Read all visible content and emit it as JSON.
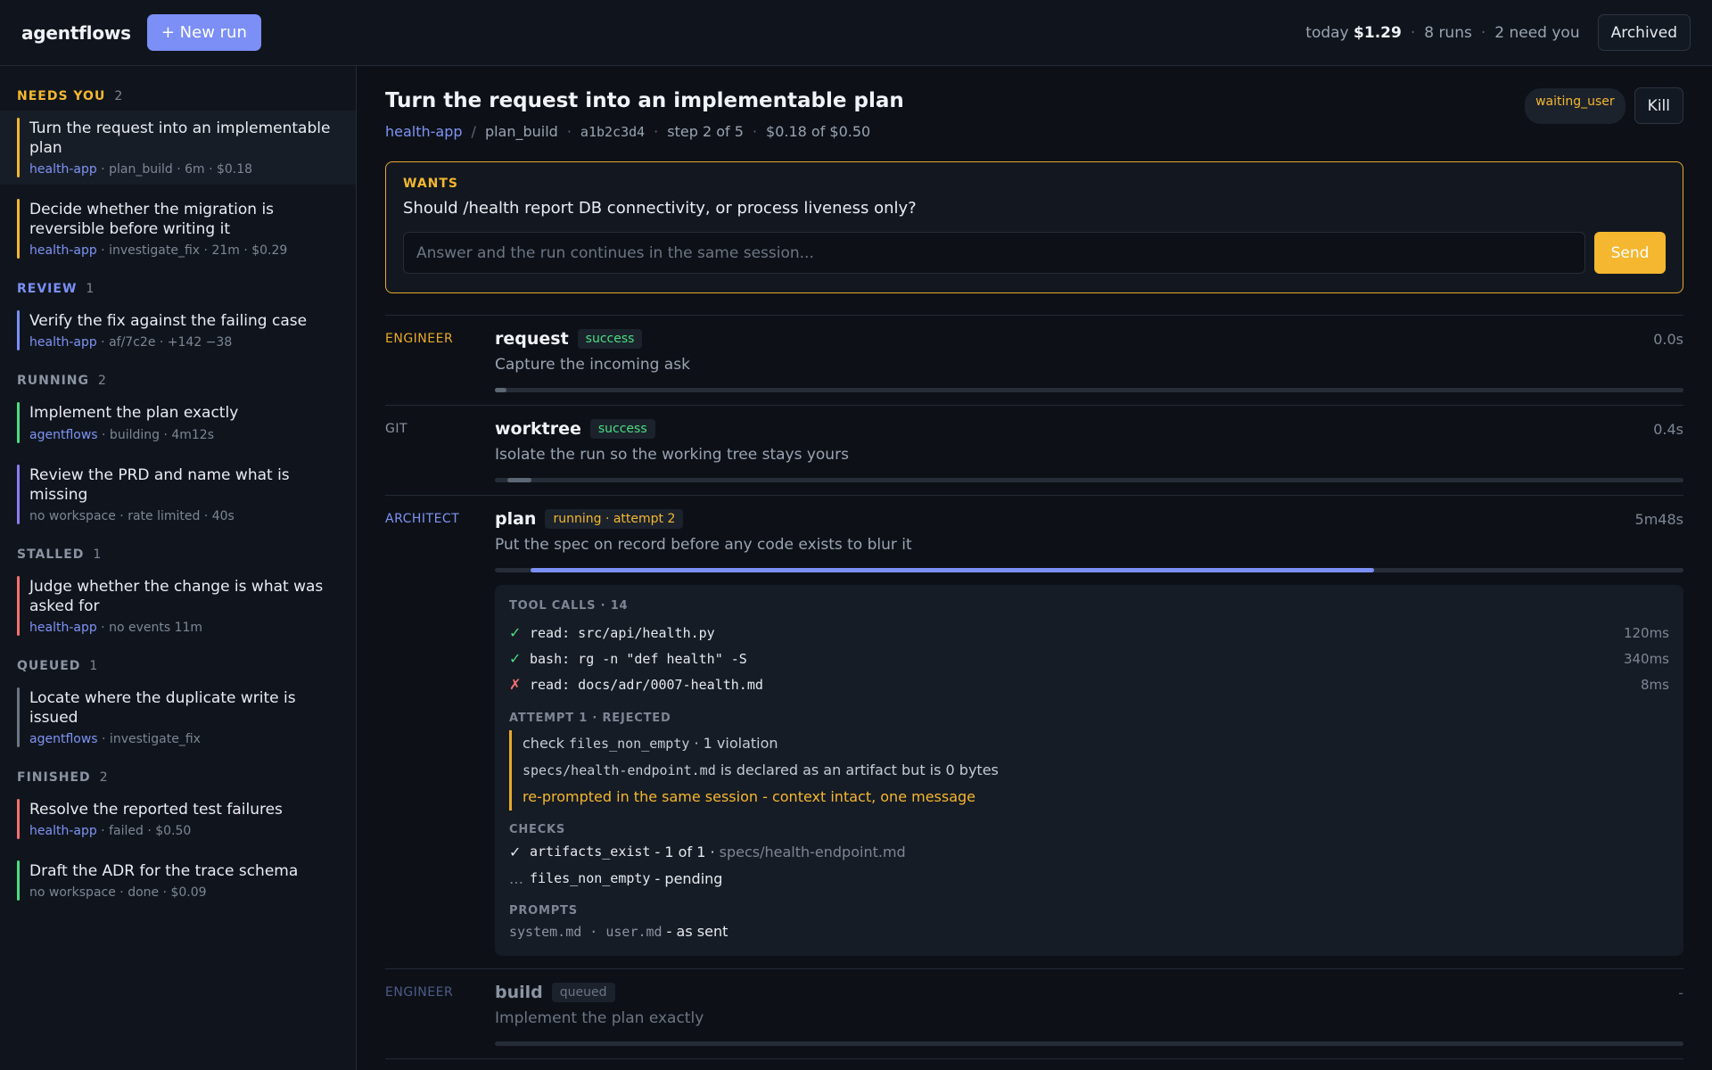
{
  "app": {
    "brand": "agentflows",
    "new_run": "+ New run",
    "archived": "Archived"
  },
  "topstats": {
    "today_label": "today",
    "today_cost": "$1.29",
    "runs": "8 runs",
    "need_you": "2 need you"
  },
  "sidebar": {
    "groups": [
      {
        "label": "NEEDS YOU",
        "count": "2",
        "items": [
          {
            "title": "Turn the request into an implementable plan",
            "ws": "health-app",
            "meta": " · plan_build · 6m · $0.18",
            "color": "#f5b730"
          },
          {
            "title": "Decide whether the migration is reversible before writing it",
            "ws": "health-app",
            "meta": " · investigate_fix · 21m · $0.29",
            "color": "#f5b730"
          }
        ]
      },
      {
        "label": "REVIEW",
        "count": "1",
        "items": [
          {
            "title": "Verify the fix against the failing case",
            "ws": "health-app",
            "meta": " · af/7c2e · +142 −38",
            "color": "#7b8ff7"
          }
        ]
      },
      {
        "label": "RUNNING",
        "count": "2",
        "items": [
          {
            "title": "Implement the plan exactly",
            "ws": "agentflows",
            "meta": " · building · 4m12s",
            "color": "#4ade80"
          },
          {
            "title": "Review the PRD and name what is missing",
            "ws": "",
            "meta": "no workspace · rate limited · 40s",
            "color": "#8b7cf6"
          }
        ]
      },
      {
        "label": "STALLED",
        "count": "1",
        "items": [
          {
            "title": "Judge whether the change is what was asked for",
            "ws": "health-app",
            "meta": " · no events 11m",
            "color": "#f87171"
          }
        ]
      },
      {
        "label": "QUEUED",
        "count": "1",
        "items": [
          {
            "title": "Locate where the duplicate write is issued",
            "ws": "agentflows",
            "meta": " · investigate_fix",
            "color": "#6c7584"
          }
        ]
      },
      {
        "label": "FINISHED",
        "count": "2",
        "items": [
          {
            "title": "Resolve the reported test failures",
            "ws": "health-app",
            "meta": " · failed · $0.50",
            "color": "#f87171"
          },
          {
            "title": "Draft the ADR for the trace schema",
            "ws": "",
            "meta": "no workspace · done · $0.09",
            "color": "#4ade80"
          }
        ]
      }
    ]
  },
  "run": {
    "title": "Turn the request into an implementable plan",
    "workspace": "health-app",
    "workflow": "plan_build",
    "commit": "a1b2c3d4",
    "step": "step 2 of 5",
    "cost": "$0.18 of $0.50",
    "status": "waiting_user",
    "kill": "Kill"
  },
  "wants": {
    "label": "WANTS",
    "question": "Should /health report DB connectivity, or process liveness only?",
    "placeholder": "Answer and the run continues in the same session...",
    "send": "Send"
  },
  "steps": [
    {
      "role": "ENGINEER",
      "name": "request",
      "status": "success",
      "desc": "Capture the incoming ask",
      "duration": "0.0s",
      "progress": 0.01
    },
    {
      "role": "GIT",
      "name": "worktree",
      "status": "success",
      "desc": "Isolate the run so the working tree stays yours",
      "duration": "0.4s",
      "progress": 0.02
    },
    {
      "role": "ARCHITECT",
      "name": "plan",
      "status": "running · attempt 2",
      "desc": "Put the spec on record before any code exists to blur it",
      "duration": "5m48s",
      "progress": 0.71
    },
    {
      "role": "ENGINEER",
      "name": "build",
      "status": "queued",
      "desc": "Implement the plan exactly",
      "duration": "-",
      "progress": 0
    }
  ],
  "detail": {
    "tool_calls_label": "TOOL CALLS · 14",
    "calls": [
      {
        "ok": true,
        "icon": "✓",
        "text": "read: src/api/health.py",
        "ms": "120ms"
      },
      {
        "ok": true,
        "icon": "✓",
        "text": "bash: rg -n \"def health\" -S",
        "ms": "340ms"
      },
      {
        "ok": false,
        "icon": "✗",
        "text": "read: docs/adr/0007-health.md",
        "ms": "8ms"
      }
    ],
    "attempt_label": "ATTEMPT 1 · REJECTED",
    "check_prefix": "check ",
    "check_code": "files_non_empty",
    "check_suffix": " · 1 violation",
    "violation_code": "specs/health-endpoint.md",
    "violation_text": " is declared as an artifact but is 0 bytes",
    "reprompt": "re-prompted in the same session - context intact, one message",
    "checks_label": "CHECKS",
    "check1_icon": "✓",
    "check1_code": "artifacts_exist",
    "check1_text": " - 1 of 1 · ",
    "check1_path": "specs/health-endpoint.md",
    "check2_icon": "…",
    "check2_code": "files_non_empty",
    "check2_text": " - pending",
    "prompts_label": "PROMPTS",
    "prompts_code": "system.md · user.md",
    "prompts_text": " - as sent"
  }
}
